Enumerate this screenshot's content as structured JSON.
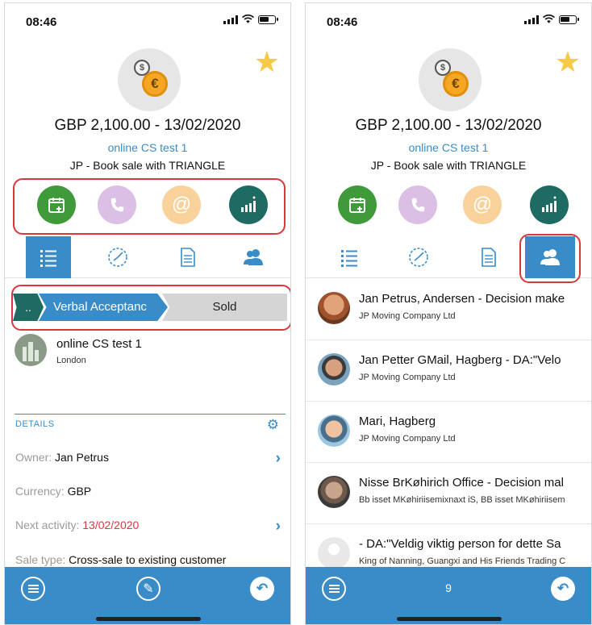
{
  "status": {
    "time": "08:46"
  },
  "deal": {
    "amount_date": "GBP 2,100.00 - 13/02/2020",
    "company_link": "online CS test 1",
    "description": "JP - Book sale with TRIANGLE"
  },
  "icons": {
    "currency_small": "$",
    "currency_big": "€",
    "star": "★"
  },
  "pipeline": {
    "stages": [
      {
        "label": ".."
      },
      {
        "label": "Verbal Acceptanc"
      },
      {
        "label": "Sold"
      }
    ]
  },
  "company": {
    "name": "online CS test 1",
    "city": "London"
  },
  "details": {
    "title": "DETAILS",
    "rows": [
      {
        "label": "Owner:",
        "value": "Jan Petrus"
      },
      {
        "label": "Currency:",
        "value": "GBP"
      },
      {
        "label": "Next activity:",
        "value": "13/02/2020"
      },
      {
        "label": "Sale type:",
        "value": "Cross-sale to existing customer"
      }
    ]
  },
  "contacts": [
    {
      "name": "Jan Petrus, Andersen - Decision make",
      "org": "JP Moving Company Ltd"
    },
    {
      "name": "Jan Petter GMail, Hagberg - DA:\"Velo",
      "org": "JP Moving Company Ltd"
    },
    {
      "name": "Mari, Hagberg",
      "org": "JP Moving Company Ltd"
    },
    {
      "name": "Nisse BrKøhirich Office - Decision mal",
      "org": "Bb isset MKøhiriisemixnaxt iS, BB isset MKøhiriisem"
    },
    {
      "name": "- DA:\"Veldig viktig person for dette Sa",
      "org": "King of Nanning, Guangxi and His Friends Trading C"
    }
  ],
  "bottom": {
    "contact_count": "9"
  },
  "colors": {
    "accent": "#3a8cc8",
    "highlight": "#d9363e",
    "calendar": "#3f9b3a",
    "phone": "#dcbfe4",
    "mail": "#f8d29a",
    "chart": "#1d6b63"
  }
}
